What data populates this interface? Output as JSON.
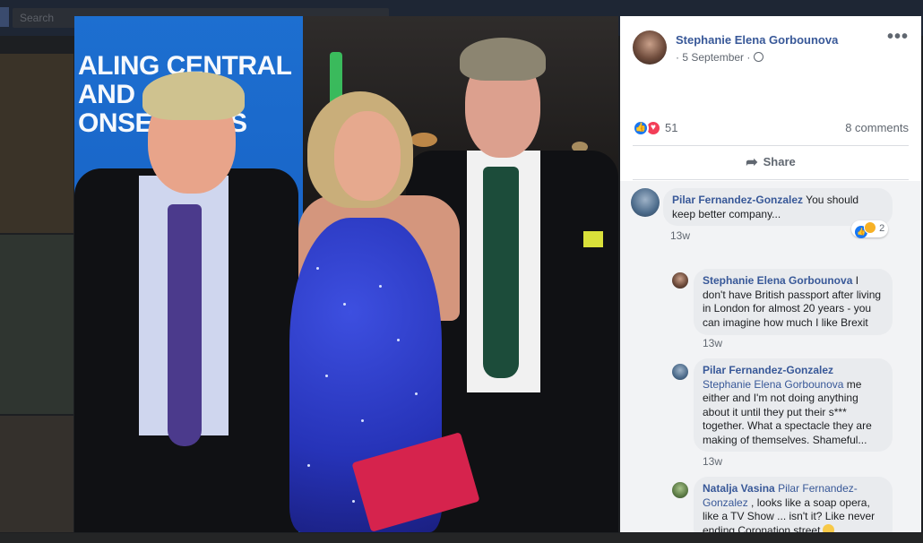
{
  "background": {
    "search_placeholder": "Search"
  },
  "post": {
    "author": "Stephanie Elena Gorbounova",
    "date": "· 5 September ·",
    "more_label": "•••",
    "reaction_count": "51",
    "comments_count": "8 comments",
    "share_label": "Share"
  },
  "photo": {
    "banner_text": "ALING CENTRAL\nAND    N\nONSE      VES"
  },
  "comments": [
    {
      "author": "Pilar Fernandez-Gonzalez",
      "text": " You should keep better company...",
      "time": "13w",
      "reaction_count": "2"
    },
    {
      "author": "Stephanie Elena Gorbounova",
      "text": " I don't have British passport after living in London for almost 20 years - you can imagine how much I like Brexit",
      "time": "13w"
    },
    {
      "author": "Pilar Fernandez-Gonzalez",
      "mention": "Stephanie Elena Gorbounova",
      "text": " me either and I'm not doing anything about it until they put their s*** together. What a spectacle they are making of themselves. Shameful...",
      "time": "13w"
    },
    {
      "author": "Natalja Vasina",
      "mention": "Pilar Fernandez-Gonzalez",
      "text": " , looks like a soap opera, like a TV Show ... isn't it? Like never ending Coronation street"
    }
  ]
}
